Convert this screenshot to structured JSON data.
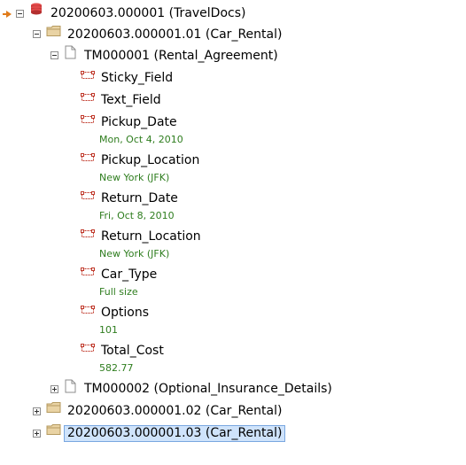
{
  "tree": {
    "root": {
      "label": "20200603.000001 (TravelDocs)"
    },
    "folder1": {
      "label": "20200603.000001.01 (Car_Rental)"
    },
    "doc1": {
      "label": "TM000001 (Rental_Agreement)"
    },
    "fields": [
      {
        "name": "Sticky_Field",
        "value": ""
      },
      {
        "name": "Text_Field",
        "value": ""
      },
      {
        "name": "Pickup_Date",
        "value": "Mon, Oct 4, 2010"
      },
      {
        "name": "Pickup_Location",
        "value": "New York (JFK)"
      },
      {
        "name": "Return_Date",
        "value": "Fri, Oct 8, 2010"
      },
      {
        "name": "Return_Location",
        "value": "New York (JFK)"
      },
      {
        "name": "Car_Type",
        "value": "Full size"
      },
      {
        "name": "Options",
        "value": "101"
      },
      {
        "name": "Total_Cost",
        "value": "582.77"
      }
    ],
    "doc2": {
      "label": "TM000002 (Optional_Insurance_Details)"
    },
    "folder2": {
      "label": "20200603.000001.02 (Car_Rental)"
    },
    "folder3": {
      "label": "20200603.000001.03 (Car_Rental)",
      "selected": true
    }
  },
  "colors": {
    "value_text": "#2e7d1e",
    "selection_bg": "#cfe3fb",
    "selection_border": "#7aa7e0",
    "field_icon": "#c0392b"
  },
  "icons": {
    "root": "stack-db-icon",
    "folder": "folder-icon",
    "document": "document-icon",
    "field": "field-icon"
  }
}
